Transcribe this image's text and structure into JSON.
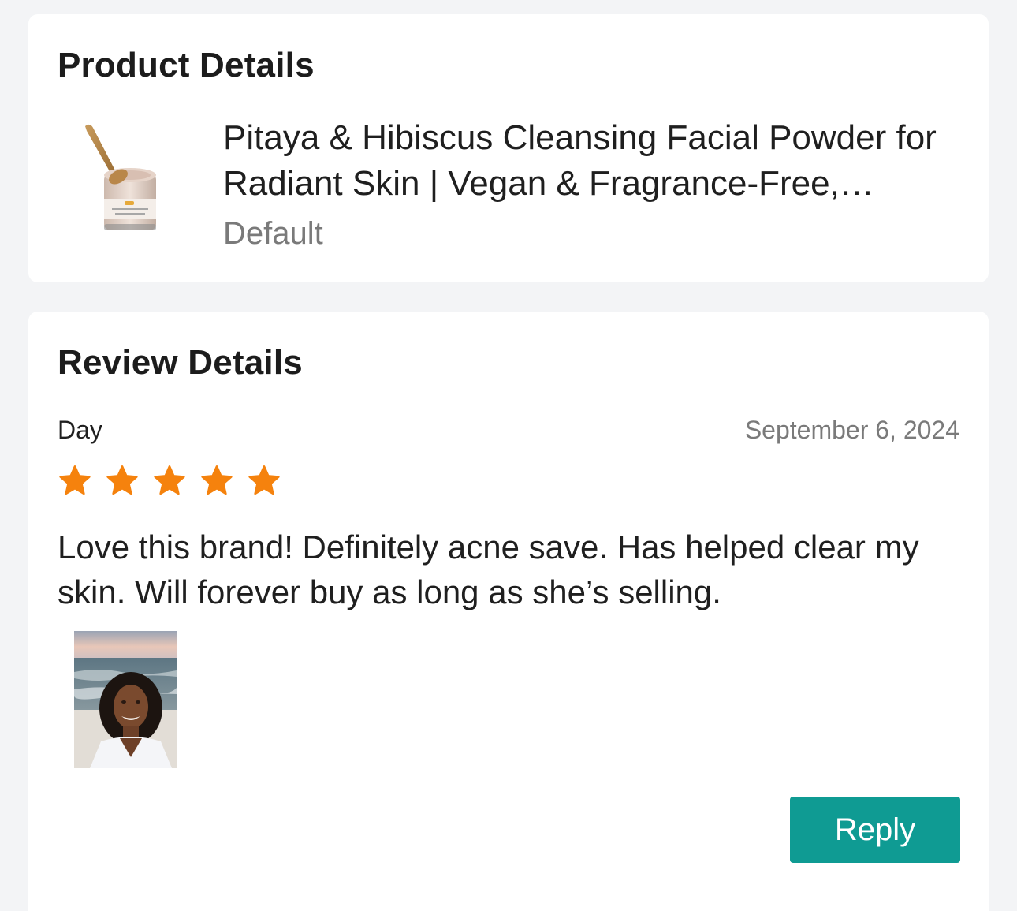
{
  "product_section": {
    "title": "Product Details",
    "product": {
      "name": "Pitaya & Hibiscus Cleansing Facial Powder for Radiant Skin | Vegan & Fragrance-Free, Gentle Exfoliating Cleanser",
      "variant": "Default",
      "thumbnail": "product-jar-with-wooden-scoop"
    }
  },
  "review_section": {
    "title": "Review Details",
    "reviewer_name": "Day",
    "date": "September 6, 2024",
    "rating": 5,
    "rating_max": 5,
    "star_color": "#f5820d",
    "text": "Love this brand! Definitely acne save. Has helped clear my skin. Will forever buy as long as she’s selling.",
    "photo": "reviewer-selfie-at-beach",
    "reply_label": "Reply",
    "reply_color": "#0f9b93"
  }
}
